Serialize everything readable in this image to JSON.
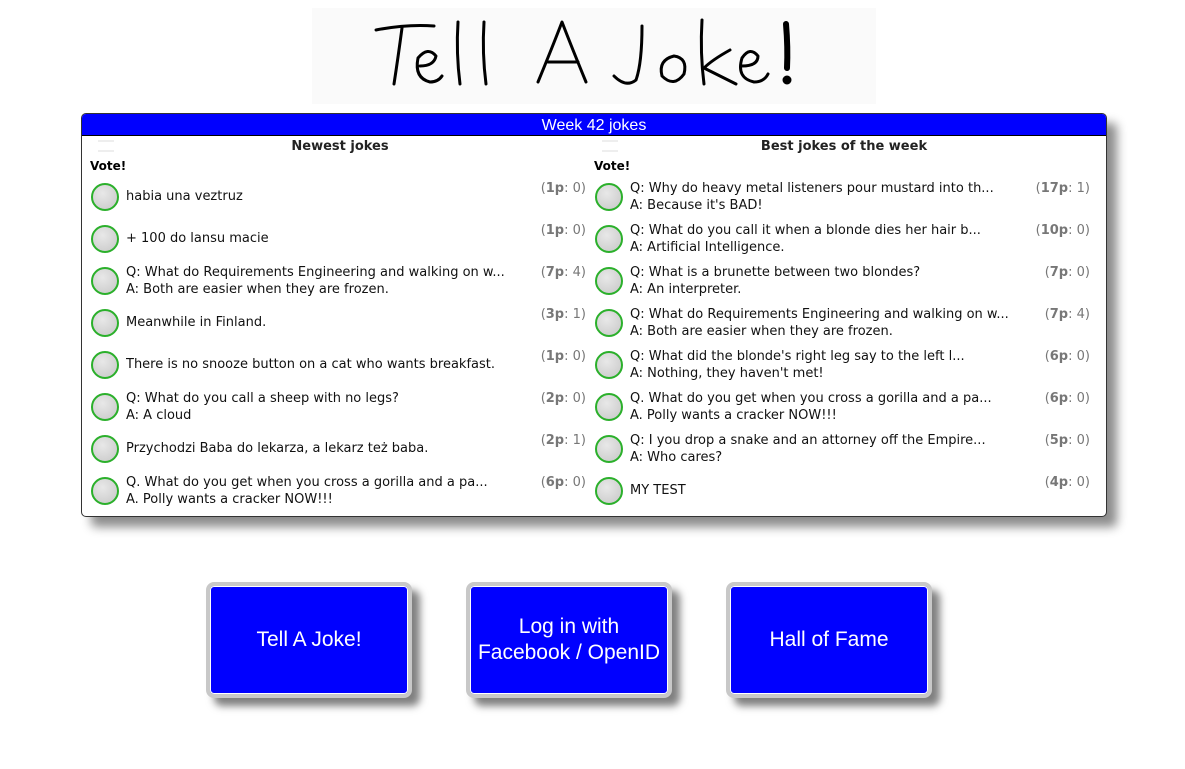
{
  "site": {
    "logo_text": "Tell A Joke!"
  },
  "panel": {
    "title": "Week 42 jokes",
    "newest": {
      "title": "Newest jokes",
      "vote_label": "Vote!",
      "jokes": [
        {
          "line1": "habia una veztruz",
          "line2": "",
          "score_points": "1p",
          "score_extra": "0"
        },
        {
          "line1": "+ 100 do lansu macie",
          "line2": "",
          "score_points": "1p",
          "score_extra": "0"
        },
        {
          "line1": "Q: What do Requirements Engineering and walking on w...",
          "line2": "A: Both are easier when they are frozen.",
          "score_points": "7p",
          "score_extra": "4"
        },
        {
          "line1": "Meanwhile in Finland.",
          "line2": "",
          "score_points": "3p",
          "score_extra": "1"
        },
        {
          "line1": "There is no snooze button on a cat who wants breakfast.",
          "line2": "",
          "score_points": "1p",
          "score_extra": "0"
        },
        {
          "line1": "Q: What do you call a sheep with no legs?",
          "line2": "A: A cloud",
          "score_points": "2p",
          "score_extra": "0"
        },
        {
          "line1": "Przychodzi Baba do lekarza, a lekarz też baba.",
          "line2": "",
          "score_points": "2p",
          "score_extra": "1"
        },
        {
          "line1": "Q. What do you get when you cross a gorilla and a pa...",
          "line2": "A. Polly wants a cracker NOW!!!",
          "score_points": "6p",
          "score_extra": "0"
        }
      ]
    },
    "best": {
      "title": "Best jokes of the week",
      "vote_label": "Vote!",
      "jokes": [
        {
          "line1": "Q: Why do heavy metal listeners pour mustard into th...",
          "line2": "A: Because it's BAD!",
          "score_points": "17p",
          "score_extra": "1"
        },
        {
          "line1": "Q: What do you call it when a blonde dies her hair b...",
          "line2": "A: Artificial Intelligence.",
          "score_points": "10p",
          "score_extra": "0"
        },
        {
          "line1": "Q: What is a brunette between two blondes?",
          "line2": "A: An interpreter.",
          "score_points": "7p",
          "score_extra": "0"
        },
        {
          "line1": "Q: What do Requirements Engineering and walking on w...",
          "line2": "A: Both are easier when they are frozen.",
          "score_points": "7p",
          "score_extra": "4"
        },
        {
          "line1": "Q: What did the blonde's right leg say to the left l...",
          "line2": "A: Nothing, they haven't met!",
          "score_points": "6p",
          "score_extra": "0"
        },
        {
          "line1": "Q. What do you get when you cross a gorilla and a pa...",
          "line2": "A. Polly wants a cracker NOW!!!",
          "score_points": "6p",
          "score_extra": "0"
        },
        {
          "line1": "Q: I you drop a snake and an attorney off the Empire...",
          "line2": "A: Who cares?",
          "score_points": "5p",
          "score_extra": "0"
        },
        {
          "line1": "MY TEST",
          "line2": "",
          "score_points": "4p",
          "score_extra": "0"
        }
      ]
    }
  },
  "buttons": {
    "tell_joke": "Tell A Joke!",
    "login_line1": "Log in with",
    "login_line2": "Facebook / OpenID",
    "hall_of_fame": "Hall of Fame"
  },
  "colors": {
    "accent": "#0000ff",
    "vote_ring": "#2bb02b"
  }
}
